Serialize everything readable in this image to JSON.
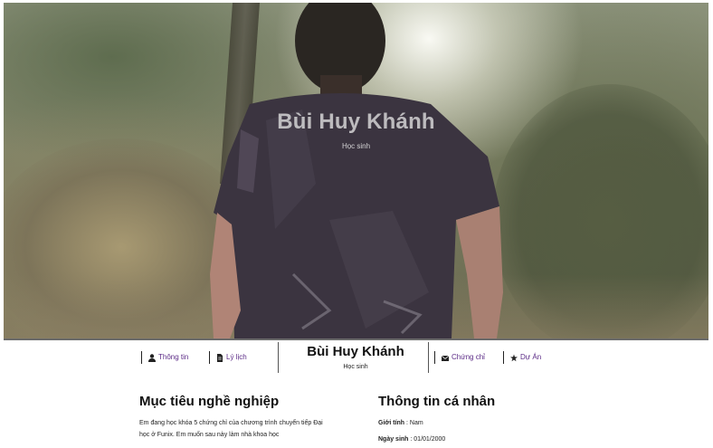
{
  "hero": {
    "name": "Bùi Huy Khánh",
    "role": "Học sinh"
  },
  "nav": {
    "items": [
      {
        "label": "Thông tin",
        "icon": "user-icon"
      },
      {
        "label": "Lý lịch",
        "icon": "document-icon"
      },
      {
        "label": "Chứng chỉ",
        "icon": "envelope-icon"
      },
      {
        "label": "Dự Án",
        "icon": "star-icon"
      }
    ],
    "name": "Bùi Huy Khánh",
    "role": "Học sinh"
  },
  "career": {
    "title": "Mục tiêu nghề nghiệp",
    "text": "Em đang học khóa 5 chứng chỉ của chương trình chuyển tiếp Đại học ở Funix. Em muốn sau này làm nhà khoa học"
  },
  "personal": {
    "title": "Thông tin cá nhân",
    "rows": [
      {
        "label": "Giới tính",
        "value": " : Nam"
      },
      {
        "label": "Ngày sinh",
        "value": " : 01/01/2000"
      }
    ]
  },
  "colors": {
    "link": "#5b2a86",
    "text": "#111111"
  }
}
